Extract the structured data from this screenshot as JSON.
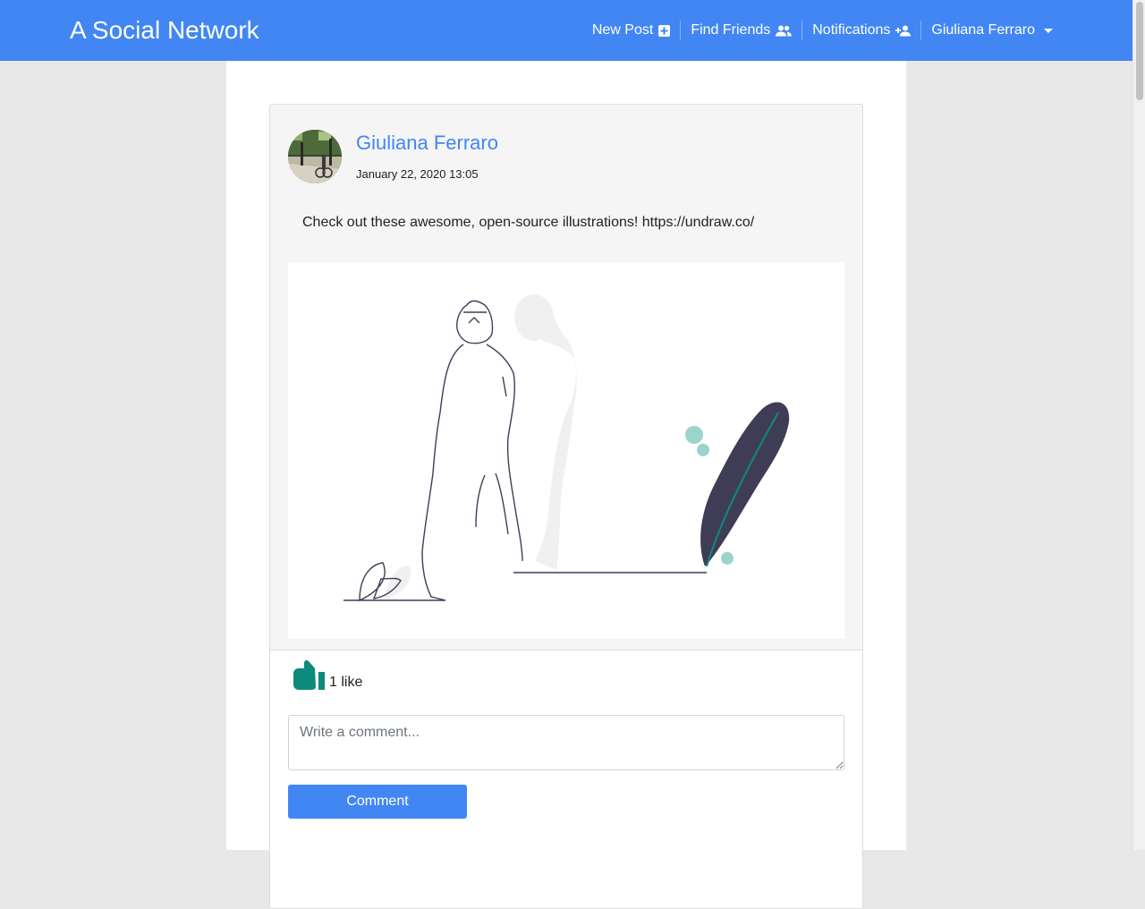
{
  "navbar": {
    "brand": "A Social Network",
    "new_post": "New Post",
    "find_friends": "Find Friends",
    "notifications": "Notifications",
    "user_menu": "Giuliana Ferraro",
    "background_color": "#4286f4"
  },
  "post": {
    "author": "Giuliana Ferraro",
    "timestamp": "January 22, 2020 13:05",
    "text": "Check out these awesome, open-source illustrations! https://undraw.co/",
    "likes_label": "1 like",
    "comment_placeholder": "Write a comment...",
    "comment_button": "Comment"
  },
  "colors": {
    "accent": "#4286f4",
    "like_icon": "#0e8a7c",
    "illustration_dark": "#3f3d56",
    "illustration_teal": "#9bd3cd"
  },
  "icons": {
    "new_post": "plus-square-icon",
    "find_friends": "people-icon",
    "notifications": "person-add-icon",
    "user_menu": "caret-down-icon",
    "likes": "thumbs-up-icon"
  }
}
